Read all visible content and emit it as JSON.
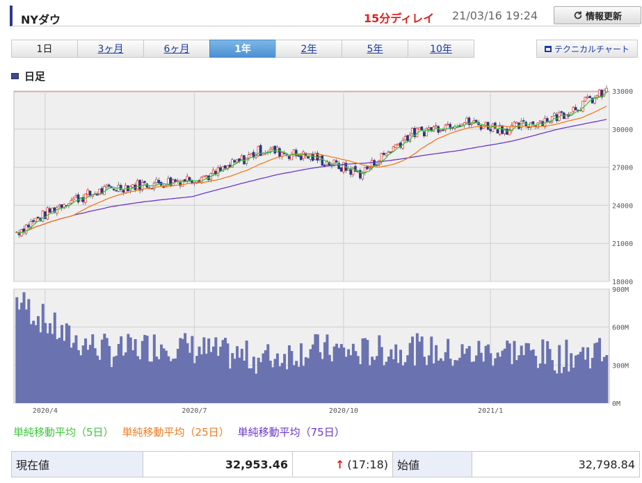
{
  "header": {
    "title": "NYダウ",
    "delay": "15分ディレイ",
    "timestamp": "21/03/16 19:24",
    "refresh_label": "情報更新",
    "refresh_icon": "refresh-icon"
  },
  "tabs": [
    {
      "label": "1日",
      "active": false
    },
    {
      "label": "3ヶ月",
      "active": false
    },
    {
      "label": "6ヶ月",
      "active": false
    },
    {
      "label": "1年",
      "active": true
    },
    {
      "label": "2年",
      "active": false
    },
    {
      "label": "5年",
      "active": false
    },
    {
      "label": "10年",
      "active": false
    }
  ],
  "technical_button": "テクニカルチャート",
  "section_title": "日足",
  "legend": [
    {
      "label": "単純移動平均（5日）",
      "color": "#3cc43c"
    },
    {
      "label": "単純移動平均（25日）",
      "color": "#f07a1e"
    },
    {
      "label": "単純移動平均（75日）",
      "color": "#6a35c8"
    }
  ],
  "chart_data": {
    "type": "candlestick",
    "x_labels": [
      "2020/4",
      "2020/7",
      "2020/10",
      "2021/1"
    ],
    "price_axis": {
      "ticks": [
        "33000",
        "30000",
        "27000",
        "24000",
        "21000",
        "18000"
      ],
      "ylim": [
        18000,
        33000
      ]
    },
    "volume_axis": {
      "ticks": [
        "900M",
        "600M",
        "300M",
        "0M"
      ],
      "ylim": [
        0,
        900
      ]
    },
    "reference_line": 32950,
    "close_monthly": [
      {
        "month": "2020/3",
        "close": 21900
      },
      {
        "month": "2020/4",
        "close": 24300
      },
      {
        "month": "2020/5",
        "close": 25400
      },
      {
        "month": "2020/6",
        "close": 25800
      },
      {
        "month": "2020/7",
        "close": 26400
      },
      {
        "month": "2020/8",
        "close": 28400
      },
      {
        "month": "2020/9",
        "close": 27800
      },
      {
        "month": "2020/10",
        "close": 26500
      },
      {
        "month": "2020/11",
        "close": 29600
      },
      {
        "month": "2020/12",
        "close": 30600
      },
      {
        "month": "2021/1",
        "close": 30000
      },
      {
        "month": "2021/2",
        "close": 31000
      },
      {
        "month": "2021/3",
        "close": 32950
      }
    ],
    "volume_monthly": [
      {
        "month": "2020/3",
        "volume": 820
      },
      {
        "month": "2020/4",
        "volume": 520
      },
      {
        "month": "2020/5",
        "volume": 400
      },
      {
        "month": "2020/6",
        "volume": 470
      },
      {
        "month": "2020/7",
        "volume": 400
      },
      {
        "month": "2020/8",
        "volume": 350
      },
      {
        "month": "2020/9",
        "volume": 430
      },
      {
        "month": "2020/10",
        "volume": 400
      },
      {
        "month": "2020/11",
        "volume": 430
      },
      {
        "month": "2020/12",
        "volume": 380
      },
      {
        "month": "2021/1",
        "volume": 420
      },
      {
        "month": "2021/2",
        "volume": 360
      },
      {
        "month": "2021/3",
        "volume": 420
      }
    ],
    "colors": {
      "up": "#e0201b",
      "down": "#1f3b8c",
      "volume": "#6a72b0",
      "grid": "#cfcfcf",
      "ref": "#f08080"
    }
  },
  "quote": {
    "current_label": "現在値",
    "current_value": "32,953.46",
    "current_time": "(17:18)",
    "open_label": "始値",
    "open_value": "32,798.84"
  }
}
